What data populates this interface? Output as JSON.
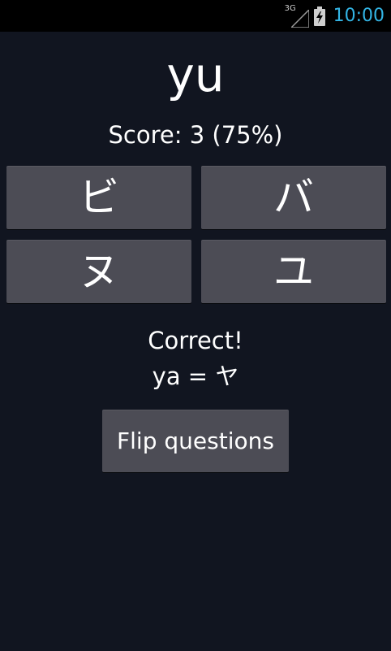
{
  "status_bar": {
    "network": "3G",
    "time": "10:00",
    "clock_color": "#33b5e5",
    "icons": [
      "signal-icon",
      "battery-charging-icon"
    ]
  },
  "quiz": {
    "question": "yu",
    "score_text": "Score: 3 (75%)",
    "answers": [
      "ビ",
      "バ",
      "ヌ",
      "ユ"
    ],
    "feedback": "Correct!",
    "feedback_detail": "ya = ヤ",
    "flip_label": "Flip questions"
  },
  "colors": {
    "background": "#111520",
    "button": "#4c4c55",
    "text": "#ffffff"
  }
}
